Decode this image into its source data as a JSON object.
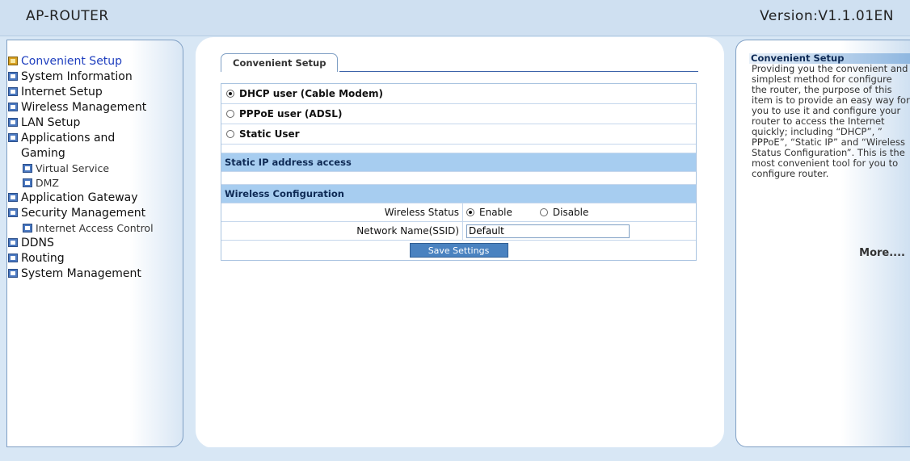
{
  "header": {
    "app_title": "AP-ROUTER",
    "version": "Version:V1.1.01EN"
  },
  "sidebar": {
    "items": [
      {
        "label": "Convenient Setup"
      },
      {
        "label": "System Information"
      },
      {
        "label": "Internet Setup"
      },
      {
        "label": "Wireless Management"
      },
      {
        "label": "LAN Setup"
      },
      {
        "label": "Applications and"
      },
      {
        "label": "Gaming"
      },
      {
        "label": "Virtual Service"
      },
      {
        "label": "DMZ"
      },
      {
        "label": "Application Gateway"
      },
      {
        "label": "Security Management"
      },
      {
        "label": "Internet Access Control"
      },
      {
        "label": "DDNS"
      },
      {
        "label": "Routing"
      },
      {
        "label": "System Management"
      }
    ]
  },
  "main": {
    "tab_label": "Convenient Setup",
    "connection_options": [
      {
        "label": "DHCP user (Cable Modem)",
        "selected": true
      },
      {
        "label": "PPPoE user (ADSL)",
        "selected": false
      },
      {
        "label": "Static User",
        "selected": false
      }
    ],
    "static_ip_section": "Static IP address access",
    "wireless_section": "Wireless Configuration",
    "wireless_status_label": "Wireless Status",
    "enable_label": "Enable",
    "disable_label": "Disable",
    "ssid_label": "Network Name(SSID)",
    "ssid_value": "Default",
    "save_button": "Save Settings"
  },
  "help": {
    "title": "Convenient Setup",
    "body": "Providing you the convenient and simplest method for configure the router, the purpose of this item is to provide an easy way for you to use it and configure your router to access the Internet quickly; including “DHCP”, ” PPPoE”, “Static IP” and “Wireless Status Configuration”. This is the most convenient tool for you to configure router.",
    "more": "More...."
  }
}
